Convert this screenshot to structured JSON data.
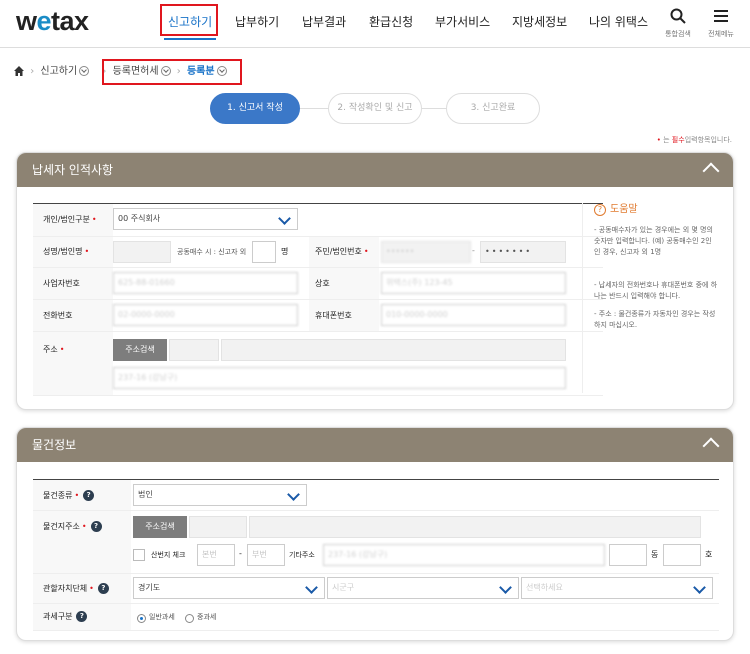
{
  "header": {
    "logo": {
      "w": "w",
      "e": "e",
      "rest": "tax"
    },
    "nav": [
      "신고하기",
      "납부하기",
      "납부결과",
      "환급신청",
      "부가서비스",
      "지방세정보",
      "나의 위택스"
    ],
    "search_caption": "통합검색",
    "menu_caption": "전체메뉴"
  },
  "breadcrumb": {
    "level1": "신고하기",
    "level2": "등록면허세",
    "level3": "등록분"
  },
  "steps": [
    "1. 신고서 작성",
    "2. 작성확인 및 신고",
    "3. 신고완료"
  ],
  "required_note": {
    "mark": "•",
    "prefix": " 는 ",
    "word": "필수",
    "suffix": "입력항목입니다."
  },
  "taxpayer": {
    "title": "납세자 인적사항",
    "person_type_label": "개인/법인구분",
    "person_type_value": "00 주식회사",
    "name_label": "성명/법인명",
    "co_owner_text": "공동매수 시 : 신고자 외",
    "co_owner_unit": "명",
    "id_label": "주민/법인번호",
    "id_mask": "•••••••",
    "biz_label": "사업자번호",
    "biz_value": "625-88-01660",
    "trade_label": "상호",
    "trade_value": "위택스(주) 123-45",
    "phone_label": "전화번호",
    "phone_value": "02-0000-0000",
    "mobile_label": "휴대폰번호",
    "mobile_value": "010-0000-0000",
    "address_label": "주소",
    "address_button": "주소검색",
    "address_detail": "237-16 (강남구)"
  },
  "help": {
    "title": "도움말",
    "items": [
      "공동매수자가 있는 경우에는 외 몇 명의 숫자만 입력합니다. (예) 공동매수인 2인인 경우, 신고자 외 1명",
      "납세자의 전화번호나 휴대폰번호 중에 하나는 반드시 입력해야 합니다.",
      "주소 : 물건종류가 자동차인 경우는 작성하지 마십시오."
    ]
  },
  "property": {
    "title": "물건정보",
    "kind_label": "물건종류",
    "kind_value": "법인",
    "addr_label": "물건지주소",
    "addr_button": "주소검색",
    "no_addr_label": "산번지 체크",
    "bonbeon_placeholder": "본번",
    "dash": "-",
    "bubeon_placeholder": "부번",
    "etc_label": "기타주소",
    "etc_value": "237-16 (강남구)",
    "dong_unit": "동",
    "ho_unit": "호",
    "district_label": "관할자치단체",
    "district_value1": "경기도",
    "district_value2": "시군구",
    "district_value3": "선택하세요",
    "taxtype_label": "과세구분",
    "taxtype_options": [
      "일반과세",
      "중과세"
    ]
  },
  "colors": {
    "accent": "#1a73c8",
    "required": "#e0161e",
    "panel_header": "#8d8373",
    "highlight_box": "#e0161e"
  }
}
